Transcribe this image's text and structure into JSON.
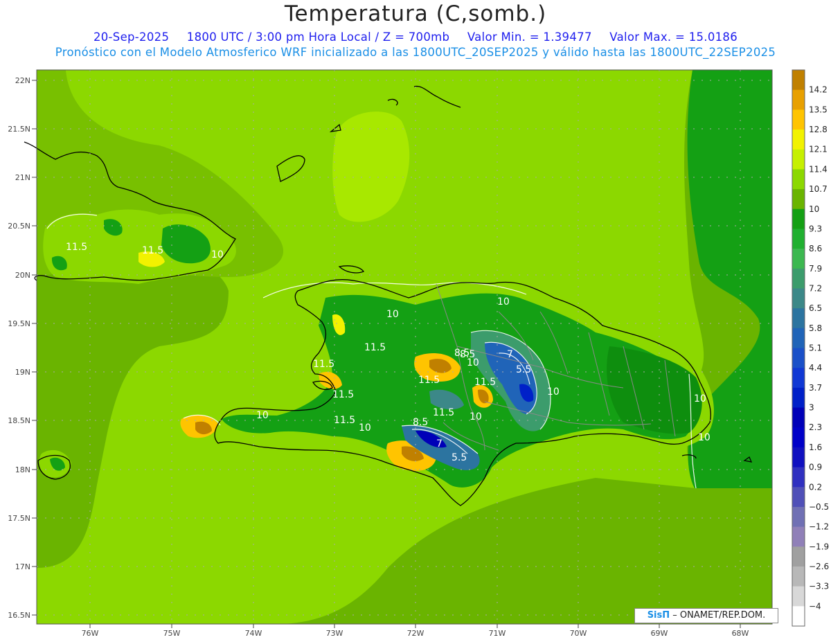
{
  "header": {
    "title": "Temperatura (C,somb.)",
    "date": "20-Sep-2025",
    "time": "1800 UTC / 3:00 pm Hora Local / Z = 700mb",
    "min_label": "Valor Min. = 1.39477",
    "max_label": "Valor Max. = 15.0186",
    "model_line": "Pronóstico con el Modelo Atmosferico WRF inicializado a las 1800UTC_20SEP2025 y válido hasta las  1800UTC_22SEP2025"
  },
  "map": {
    "lat_labels": [
      "22N",
      "21.5N",
      "21N",
      "20.5N",
      "20N",
      "19.5N",
      "19N",
      "18.5N",
      "18N",
      "17.5N",
      "17N",
      "16.5N"
    ],
    "lon_labels": [
      "76W",
      "75W",
      "74W",
      "73W",
      "72W",
      "71W",
      "70W",
      "69W",
      "68W"
    ],
    "contour_labels": [
      "11.5",
      "11.5",
      "10",
      "10",
      "11.5",
      "10",
      "11.5",
      "11.5",
      "10",
      "8.5",
      "7",
      "5.5",
      "11.5",
      "11.5",
      "11.5",
      "10",
      "10",
      "11.5",
      "10",
      "8.5",
      "7",
      "5.5",
      "10",
      "10",
      "8.5",
      "10"
    ]
  },
  "colorbar": {
    "labels": [
      "14.2",
      "13.5",
      "12.8",
      "12.1",
      "11.4",
      "10.7",
      "10",
      "9.3",
      "8.6",
      "7.9",
      "7.2",
      "6.5",
      "5.8",
      "5.1",
      "4.4",
      "3.7",
      "3",
      "2.3",
      "1.6",
      "0.9",
      "0.2",
      "−0.5",
      "−1.2",
      "−1.9",
      "−2.6",
      "−3.3",
      "−4"
    ],
    "colors": [
      "#c08000",
      "#e8a000",
      "#ffc400",
      "#f2f200",
      "#c6f000",
      "#8cd800",
      "#6ab400",
      "#14a014",
      "#20b030",
      "#3cb850",
      "#3c9c6c",
      "#3c8888",
      "#2c74a0",
      "#2064b8",
      "#1a50c8",
      "#1038d4",
      "#0020c8",
      "#0000b8",
      "#0000c8",
      "#1010c0",
      "#3030c0",
      "#5050b8",
      "#7070b4",
      "#9080b8",
      "#a0a0a0",
      "#b8b8b8",
      "#d8d8d8",
      "#ffffff"
    ]
  },
  "credit": {
    "logo": "SisΠ",
    "text": "– ONAMET/REP.DOM."
  }
}
